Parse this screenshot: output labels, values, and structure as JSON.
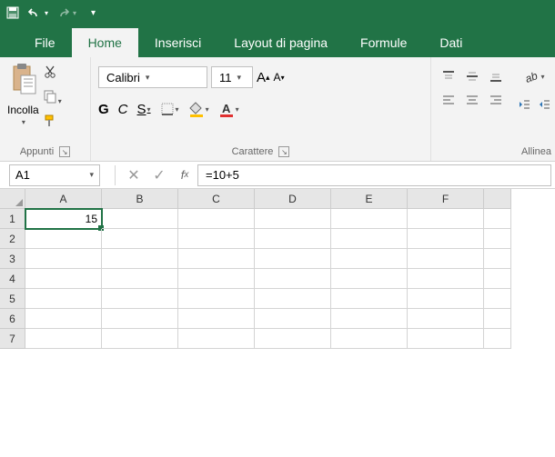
{
  "quickAccess": {
    "saveTitle": "Salva",
    "undoTitle": "Annulla",
    "redoTitle": "Ripeti"
  },
  "tabs": {
    "file": "File",
    "home": "Home",
    "insert": "Inserisci",
    "pageLayout": "Layout di pagina",
    "formulas": "Formule",
    "data": "Dati"
  },
  "ribbon": {
    "clipboard": {
      "paste": "Incolla",
      "label": "Appunti"
    },
    "font": {
      "name": "Calibri",
      "size": "11",
      "bold": "G",
      "italic": "C",
      "underline": "S",
      "label": "Carattere"
    },
    "alignment": {
      "label": "Allinea"
    }
  },
  "nameBox": "A1",
  "formula": "=10+5",
  "columns": [
    "A",
    "B",
    "C",
    "D",
    "E",
    "F"
  ],
  "rows": [
    "1",
    "2",
    "3",
    "4",
    "5",
    "6",
    "7"
  ],
  "cells": {
    "A1": "15"
  },
  "selected": "A1",
  "colors": {
    "brand": "#217346",
    "fontAccent": "#e03030",
    "fillAccent": "#ffc000"
  }
}
